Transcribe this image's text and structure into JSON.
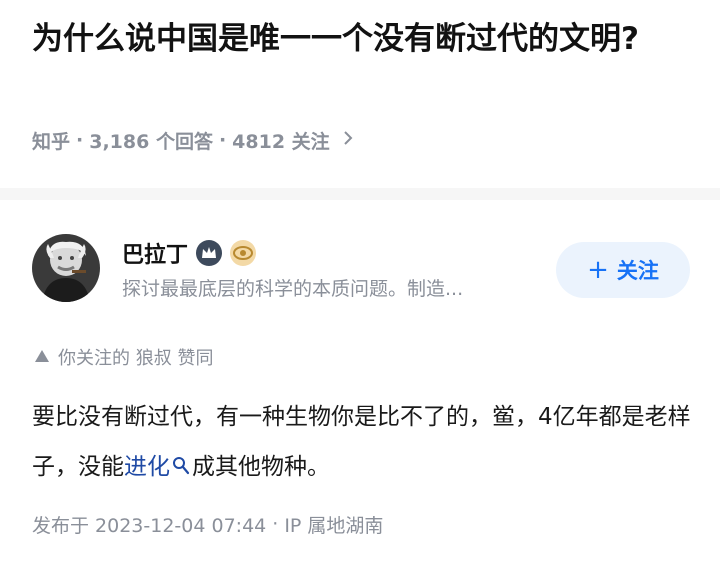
{
  "question": {
    "title": "为什么说中国是唯一一个没有断过代的文明?",
    "source": "知乎",
    "answers": "3,186 个回答",
    "followers": "4812 关注"
  },
  "author": {
    "name": "巴拉丁",
    "bio": "探讨最最底层的科学的本质问题。制造..."
  },
  "follow_button": {
    "label": "关注"
  },
  "social": {
    "text": "你关注的 狼叔 赞同"
  },
  "answer": {
    "text_before": "要比没有断过代，有一种生物你是比不了的，鲎，4亿年都是老样子，没能",
    "keyword": "进化",
    "text_after": "成其他物种。"
  },
  "footer": {
    "published": "发布于 2023-12-04 07:44",
    "location": "IP 属地湖南"
  },
  "colors": {
    "accent": "#1772f6",
    "keyword": "#1f4aa5",
    "muted": "#8a8f99",
    "follow_bg": "#ebf3fd"
  },
  "icons": [
    "chevron-right-icon",
    "crown-badge-icon",
    "eye-badge-icon",
    "up-triangle-icon",
    "search-icon",
    "plus-icon"
  ]
}
